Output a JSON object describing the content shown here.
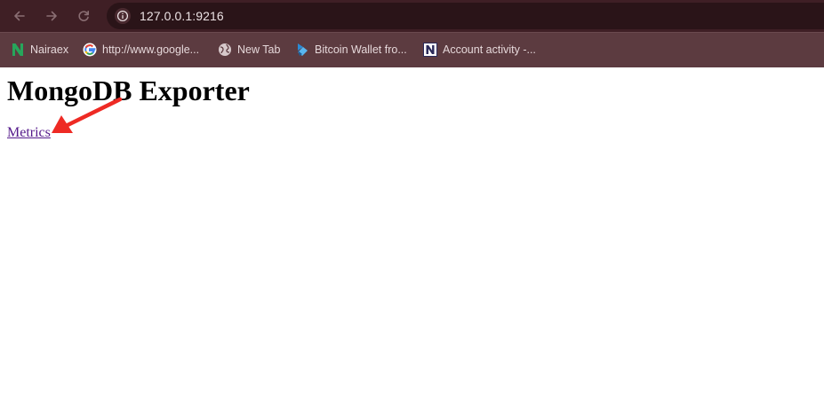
{
  "browser": {
    "url": "127.0.0.1:9216",
    "bookmarks": [
      {
        "label": "Nairaex",
        "icon": "nairaex-n-icon"
      },
      {
        "label": "http://www.google...",
        "icon": "google-g-icon"
      },
      {
        "label": "New Tab",
        "icon": "globe-icon"
      },
      {
        "label": "Bitcoin Wallet fro...",
        "icon": "bitcoin-wallet-icon"
      },
      {
        "label": "Account activity -...",
        "icon": "n-logo-icon"
      }
    ]
  },
  "page": {
    "title": "MongoDB Exporter",
    "link_label": "Metrics"
  },
  "colors": {
    "toolbar": "#3f1f25",
    "bookmarks_bar": "#5c3b40",
    "visited_link": "#551a8b",
    "annotation_arrow": "#ee2a24"
  }
}
